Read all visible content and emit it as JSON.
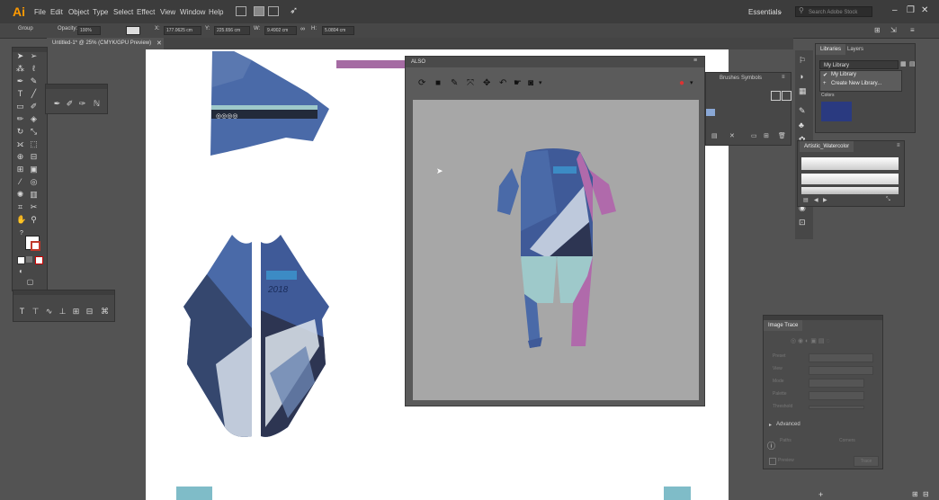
{
  "app": {
    "logo": "Ai"
  },
  "menubar": {
    "items": [
      "File",
      "Edit",
      "Object",
      "Type",
      "Select",
      "Effect",
      "View",
      "Window",
      "Help"
    ],
    "workspace": "Essentials",
    "search_placeholder": "Search Adobe Stock"
  },
  "control_bar": {
    "selection": "Group",
    "opacity_label": "Opacity:",
    "opacity_value": "100%",
    "x_label": "X:",
    "x_value": "177.0625 cm",
    "y_label": "Y:",
    "y_value": "225.656 cm",
    "w_label": "W:",
    "w_value": "9.4902 cm",
    "h_label": "H:",
    "h_value": "5.0804 cm"
  },
  "document": {
    "tab_label": "Untitled-1* @ 25% (CMYK/GPU Preview)"
  },
  "plugin_window": {
    "title": "ALSO"
  },
  "right_panels": {
    "tabs": [
      "Libraries",
      "Layers"
    ],
    "library_select": "My Library",
    "library_menu": [
      "My Library",
      "Create New Library..."
    ],
    "colors_label": "Colors",
    "middle_tabs": [
      "Brushes",
      "Symbols"
    ],
    "brush_panel_title": "Artistic_Watercolor",
    "accent": "#2a3a80"
  },
  "image_trace": {
    "title": "Image Trace",
    "rows": [
      "Preset",
      "View",
      "Mode",
      "Palette",
      "Threshold"
    ],
    "advanced_label": "Advanced",
    "paths_label": "Paths",
    "corners_label": "Corners",
    "preview_label": "Preview",
    "trace_button": "Trace"
  },
  "design": {
    "year_text": "2018"
  },
  "colors": {
    "suit_blue": "#4a6aa8",
    "suit_pink": "#b06aab",
    "suit_teal": "#9ec9ca",
    "dark": "#2d3552",
    "bar": "#a56ba3"
  }
}
